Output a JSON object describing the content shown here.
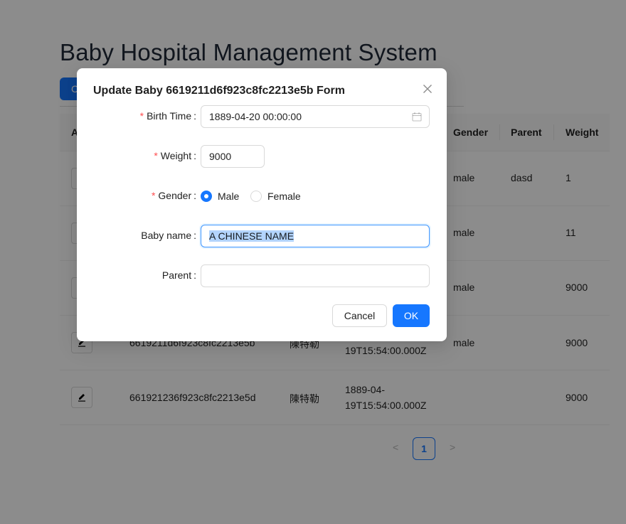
{
  "page": {
    "title": "Baby Hospital Management System",
    "create_button": "C"
  },
  "table": {
    "columns": [
      "A",
      "Gender",
      "Parent",
      "Weight"
    ],
    "rows": [
      {
        "id": "",
        "name": "",
        "birth1": "",
        "birth2": "",
        "gender": "male",
        "parent": "dasd",
        "weight": "1"
      },
      {
        "id": "",
        "name": "",
        "birth1": "",
        "birth2": "",
        "gender": "male",
        "parent": "",
        "weight": "11"
      },
      {
        "id": "",
        "name": "",
        "birth1": "",
        "birth2": "",
        "gender": "male",
        "parent": "",
        "weight": "9000"
      },
      {
        "id": "6619211d6f923c8fc2213e5b",
        "name": "陳特勒",
        "birth1": "",
        "birth2": "19T15:54:00.000Z",
        "gender": "male",
        "parent": "",
        "weight": "9000"
      },
      {
        "id": "661921236f923c8fc2213e5d",
        "name": "陳特勒",
        "birth1": "1889-04-",
        "birth2": "19T15:54:00.000Z",
        "gender": "",
        "parent": "",
        "weight": "9000"
      }
    ]
  },
  "pagination": {
    "prev": "<",
    "current": "1",
    "next": ">"
  },
  "modal": {
    "title": "Update Baby 6619211d6f923c8fc2213e5b Form",
    "fields": {
      "birth_time": {
        "label": "Birth Time",
        "value": "1889-04-20 00:00:00",
        "required": "*"
      },
      "weight": {
        "label": "Weight",
        "value": "9000",
        "required": "*"
      },
      "gender": {
        "label": "Gender",
        "required": "*",
        "options": [
          "Male",
          "Female"
        ],
        "selected": "Male"
      },
      "baby_name": {
        "label": "Baby name",
        "value": "A CHINESE NAME"
      },
      "parent": {
        "label": "Parent",
        "value": ""
      }
    },
    "colon": ":",
    "cancel": "Cancel",
    "ok": "OK"
  },
  "colors": {
    "primary": "#1677ff",
    "required": "#ff4d4f",
    "mask": "rgba(0,0,0,0.45)"
  },
  "icons": [
    "calendar-icon",
    "close-icon",
    "edit-icon",
    "chevron-left-icon",
    "chevron-right-icon"
  ]
}
